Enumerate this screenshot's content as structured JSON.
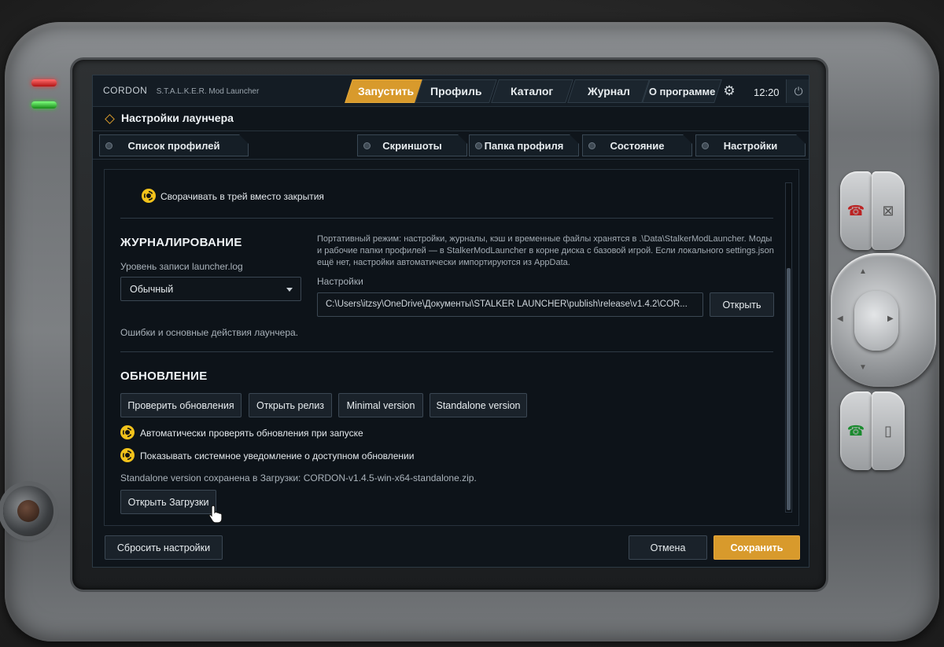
{
  "app": {
    "brand_name": "CORDON",
    "brand_sub": "S.T.A.L.K.E.R. Mod Launcher",
    "clock": "12:20"
  },
  "nav": {
    "tabs": [
      {
        "label": "Запустить",
        "active": true
      },
      {
        "label": "Профиль"
      },
      {
        "label": "Каталог"
      },
      {
        "label": "Журнал"
      },
      {
        "label": "О программе"
      }
    ]
  },
  "section": {
    "title": "Настройки лаунчера"
  },
  "subtabs": [
    {
      "label": "Список профилей"
    },
    {
      "label": "Скриншоты"
    },
    {
      "label": "Папка профиля"
    },
    {
      "label": "Состояние"
    },
    {
      "label": "Настройки"
    }
  ],
  "tray_option": "Сворачивать в трей вместо закрытия",
  "logging": {
    "title": "ЖУРНАЛИРОВАНИЕ",
    "level_label": "Уровень записи launcher.log",
    "level_value": "Обычный",
    "level_hint": "Ошибки и основные действия лаунчера.",
    "portable_note": "Портативный режим: настройки, журналы, кэш и временные файлы хранятся в .\\Data\\StalkerModLauncher. Моды и рабочие папки профилей — в StalkerModLauncher в корне диска с базовой игрой. Если локального settings.json ещё нет, настройки автоматически импортируются из AppData.",
    "settings_label": "Настройки",
    "settings_path": "C:\\Users\\itzsy\\OneDrive\\Документы\\STALKER LAUNCHER\\publish\\release\\v1.4.2\\COR...",
    "open_label": "Открыть"
  },
  "update": {
    "title": "ОБНОВЛЕНИЕ",
    "buttons": [
      "Проверить обновления",
      "Открыть релиз",
      "Minimal version",
      "Standalone version"
    ],
    "auto_check": "Автоматически проверять обновления при запуске",
    "notify": "Показывать системное уведомление о доступном обновлении",
    "saved_status": "Standalone version сохранена в Загрузки: CORDON-v1.4.5-win-x64-standalone.zip.",
    "open_downloads": "Открыть Загрузки"
  },
  "footer": {
    "reset": "Сбросить настройки",
    "cancel": "Отмена",
    "save": "Сохранить"
  },
  "colors": {
    "accent": "#d89a2c",
    "background": "#0f151b",
    "radiation_icon": "#f2c21b"
  },
  "icons": [
    "diamond-icon",
    "gear-icon",
    "power-icon",
    "radiation-icon",
    "chevron-down-icon",
    "hand-cursor-icon"
  ]
}
